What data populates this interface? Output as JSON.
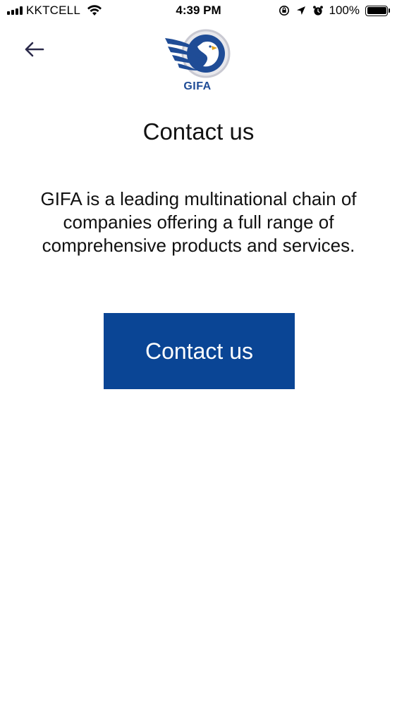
{
  "status_bar": {
    "carrier": "KKTCELL",
    "time": "4:39 PM",
    "battery_percent": "100%",
    "battery_level": 1.0
  },
  "header": {
    "logo_text": "GIFA",
    "brand_color": "#1f4c96"
  },
  "page": {
    "title": "Contact us",
    "description": "GIFA is a leading multinational chain of companies offering a full range of comprehensive products and services."
  },
  "actions": {
    "contact_label": "Contact us",
    "contact_color": "#0a4595"
  },
  "icons": {
    "back": "arrow-left-icon",
    "wifi": "wifi-icon",
    "lock_rotation": "orientation-lock-icon",
    "location": "location-arrow-icon",
    "alarm": "alarm-clock-icon",
    "battery": "battery-icon"
  }
}
